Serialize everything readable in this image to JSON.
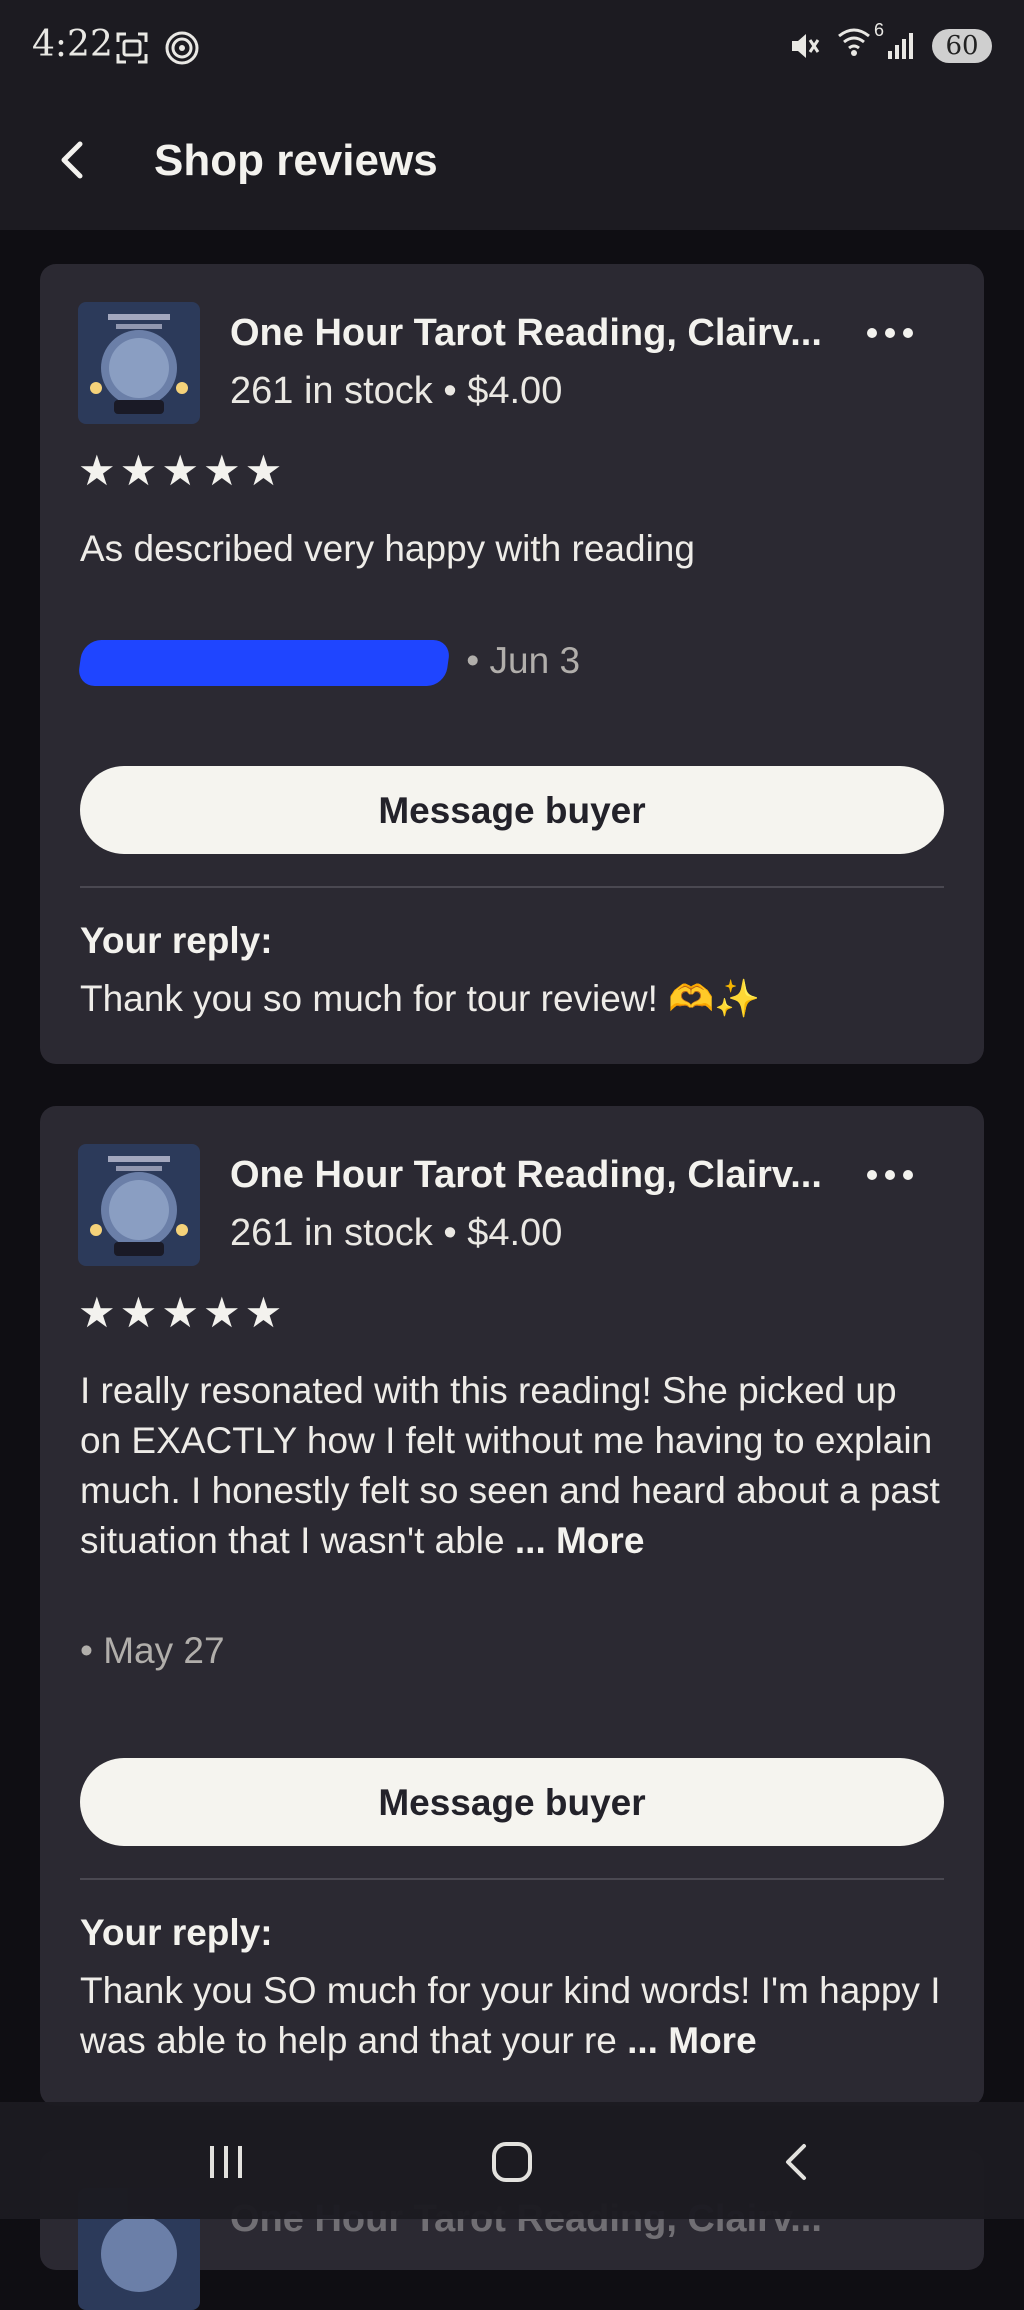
{
  "status": {
    "time": "4:22",
    "network": "6",
    "battery": "60"
  },
  "header": {
    "title": "Shop reviews"
  },
  "reviews": [
    {
      "listing_title": "One Hour Tarot Reading, Clairv...",
      "stock": "261 in stock",
      "separator": "•",
      "price": "$4.00",
      "rating": 5,
      "text": "As described very happy with reading",
      "date": "• Jun 3",
      "message_button": "Message buyer",
      "reply_label": "Your reply:",
      "reply_text": "Thank you so much for tour review! 🫶✨"
    },
    {
      "listing_title": "One Hour Tarot Reading, Clairv...",
      "stock": "261 in stock",
      "separator": "•",
      "price": "$4.00",
      "rating": 5,
      "text": "I really resonated with this reading! She picked up on EXACTLY how I felt without me having to explain much. I honestly felt so seen and heard about a past situation that I wasn't able",
      "more_label": "... More",
      "date": "• May 27",
      "message_button": "Message buyer",
      "reply_label": "Your reply:",
      "reply_text": "Thank you SO much for your kind words! I'm happy I was able to help and that your re",
      "reply_more_label": "... More"
    },
    {
      "listing_title": "One Hour Tarot Reading, Clairv..."
    }
  ],
  "colors": {
    "background": "#0f0e13",
    "card": "#2b2932",
    "header": "#1c1b21",
    "button": "#f5f4ef",
    "redaction": "#1f45ff"
  }
}
